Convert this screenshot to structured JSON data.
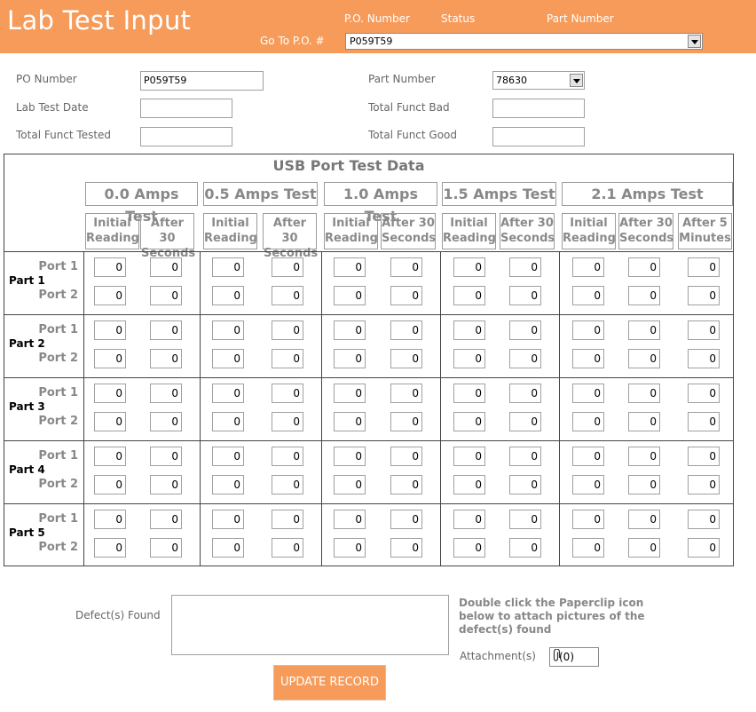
{
  "header": {
    "title": "Lab Test Input",
    "col_po_number": "P.O. Number",
    "col_status": "Status",
    "col_part_number": "Part Number",
    "goto_label": "Go To P.O. #",
    "goto_value": "P059T59"
  },
  "form": {
    "po_number_label": "PO Number",
    "po_number_value": "P059T59",
    "lab_test_date_label": "Lab Test Date",
    "lab_test_date_value": "",
    "total_funct_tested_label": "Total Funct Tested",
    "total_funct_tested_value": "",
    "part_number_label": "Part Number",
    "part_number_value": "78630",
    "total_funct_bad_label": "Total Funct Bad",
    "total_funct_bad_value": "",
    "total_funct_good_label": "Total Funct Good",
    "total_funct_good_value": ""
  },
  "grid": {
    "title": "USB Port Test Data",
    "amps": [
      "0.0 Amps Test",
      "0.5 Amps Test",
      "1.0 Amps Test",
      "1.5 Amps Test",
      "2.1 Amps Test"
    ],
    "sub_initial": "Initial Reading",
    "sub_after30": "After 30 Seconds",
    "sub_after5": "After 5 Minutes",
    "port1": "Port 1",
    "port2": "Port 2",
    "parts": [
      "Part 1",
      "Part 2",
      "Part 3",
      "Part 4",
      "Part 5"
    ],
    "cell_value": "0"
  },
  "footer": {
    "defects_label": "Defect(s) Found",
    "defects_value": "",
    "note": "Double click the Paperclip icon below to attach pictures of the defect(s) found",
    "attachments_label": "Attachment(s)",
    "attachments_value": "(0)",
    "update_button": "UPDATE RECORD"
  },
  "colors": {
    "accent": "#f79b5a"
  }
}
